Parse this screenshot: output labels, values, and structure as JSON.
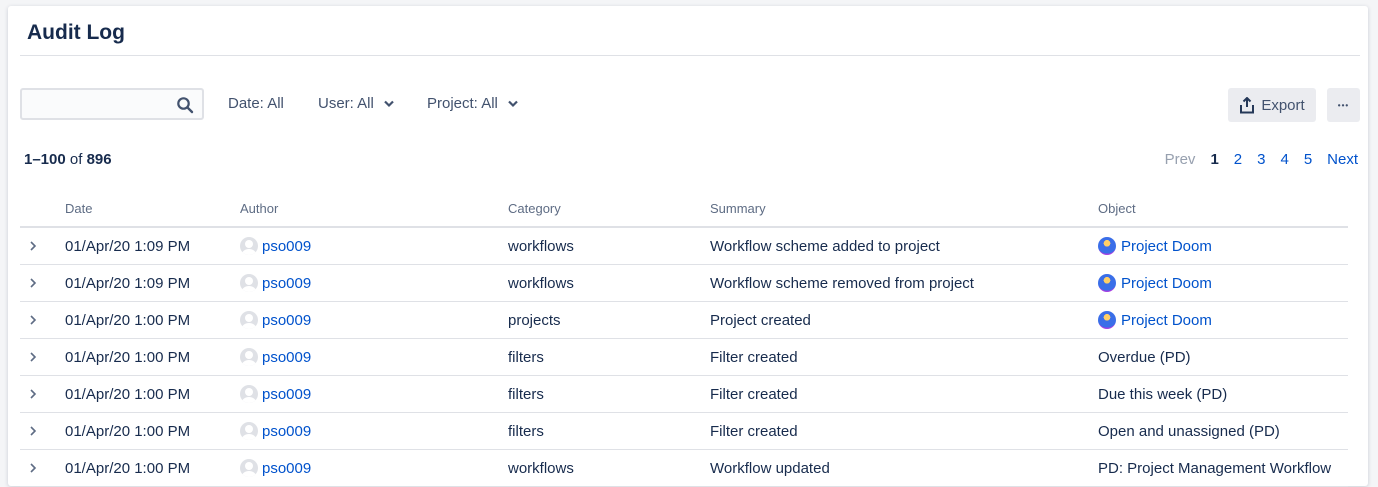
{
  "page": {
    "title": "Audit Log"
  },
  "toolbar": {
    "search_placeholder": "",
    "date_filter": "Date: All",
    "user_filter": "User: All",
    "project_filter": "Project: All",
    "export_label": "Export",
    "more_label": "•••"
  },
  "results": {
    "range": "1–100",
    "of_label": "of",
    "total": "896"
  },
  "pagination": {
    "prev": "Prev",
    "current": "1",
    "pages": [
      "2",
      "3",
      "4",
      "5"
    ],
    "next": "Next"
  },
  "columns": {
    "date": "Date",
    "author": "Author",
    "category": "Category",
    "summary": "Summary",
    "object": "Object"
  },
  "rows": [
    {
      "date": "01/Apr/20 1:09 PM",
      "author": "pso009",
      "category": "workflows",
      "summary": "Workflow scheme added to project",
      "object": "Project Doom",
      "object_is_project": true
    },
    {
      "date": "01/Apr/20 1:09 PM",
      "author": "pso009",
      "category": "workflows",
      "summary": "Workflow scheme removed from project",
      "object": "Project Doom",
      "object_is_project": true
    },
    {
      "date": "01/Apr/20 1:00 PM",
      "author": "pso009",
      "category": "projects",
      "summary": "Project created",
      "object": "Project Doom",
      "object_is_project": true
    },
    {
      "date": "01/Apr/20 1:00 PM",
      "author": "pso009",
      "category": "filters",
      "summary": "Filter created",
      "object": "Overdue (PD)",
      "object_is_project": false
    },
    {
      "date": "01/Apr/20 1:00 PM",
      "author": "pso009",
      "category": "filters",
      "summary": "Filter created",
      "object": "Due this week (PD)",
      "object_is_project": false
    },
    {
      "date": "01/Apr/20 1:00 PM",
      "author": "pso009",
      "category": "filters",
      "summary": "Filter created",
      "object": "Open and unassigned (PD)",
      "object_is_project": false
    },
    {
      "date": "01/Apr/20 1:00 PM",
      "author": "pso009",
      "category": "workflows",
      "summary": "Workflow updated",
      "object": "PD: Project Management Workflow",
      "object_is_project": false
    }
  ],
  "colors": {
    "link": "#0052cc",
    "text": "#172b4d",
    "muted": "#5e6c84",
    "border": "#dfe1e6",
    "button_bg": "#ebecf0"
  }
}
